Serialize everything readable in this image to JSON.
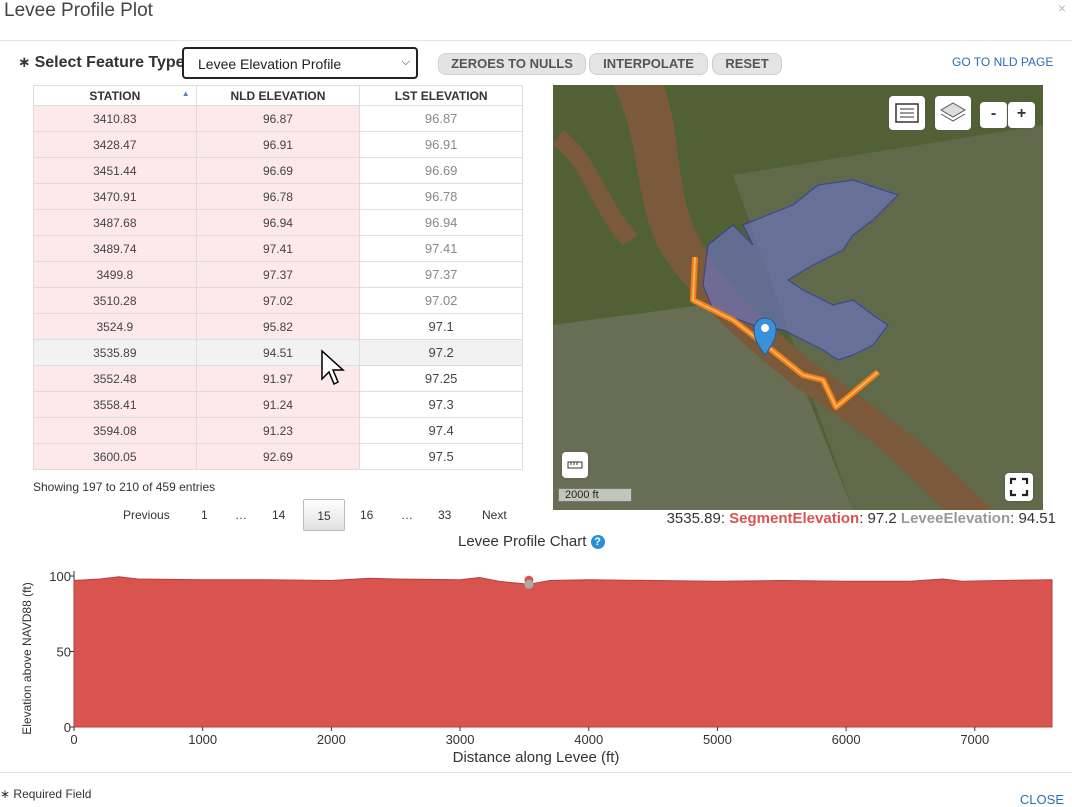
{
  "window": {
    "title": "Levee Profile Plot",
    "close_glyph": "×"
  },
  "form": {
    "required_star": "∗",
    "feature_type_label": "Select Feature Type",
    "feature_type_value": "Levee Elevation Profile"
  },
  "toolbar": {
    "zeroes_to_nulls": "ZEROES TO NULLS",
    "interpolate": "INTERPOLATE",
    "reset": "RESET",
    "nld_link": "GO TO NLD PAGE"
  },
  "table": {
    "columns": [
      "STATION",
      "NLD ELEVATION",
      "LST ELEVATION"
    ],
    "rows": [
      [
        "3410.83",
        "96.87",
        "96.87"
      ],
      [
        "3428.47",
        "96.91",
        "96.91"
      ],
      [
        "3451.44",
        "96.69",
        "96.69"
      ],
      [
        "3470.91",
        "96.78",
        "96.78"
      ],
      [
        "3487.68",
        "96.94",
        "96.94"
      ],
      [
        "3489.74",
        "97.41",
        "97.41"
      ],
      [
        "3499.8",
        "97.37",
        "97.37"
      ],
      [
        "3510.28",
        "97.02",
        "97.02"
      ],
      [
        "3524.9",
        "95.82",
        "97.1"
      ],
      [
        "3535.89",
        "94.51",
        "97.2"
      ],
      [
        "3552.48",
        "91.97",
        "97.25"
      ],
      [
        "3558.41",
        "91.24",
        "97.3"
      ],
      [
        "3594.08",
        "91.23",
        "97.4"
      ],
      [
        "3600.05",
        "92.69",
        "97.5"
      ]
    ],
    "info": "Showing 197 to 210 of 459 entries"
  },
  "pagination": {
    "previous": "Previous",
    "pages": [
      "1",
      "…",
      "14",
      "15",
      "16",
      "…",
      "33"
    ],
    "current": "15",
    "next": "Next"
  },
  "map": {
    "scale_label": "2000 ft",
    "zoom_out": "-",
    "zoom_in": "+",
    "icons": [
      "list-icon",
      "layers-icon",
      "ruler-icon",
      "fullscreen-icon",
      "map-pin-icon"
    ]
  },
  "readout": {
    "station": "3535.89:",
    "segment_label": "SegmentElevation",
    "segment_value": ": 97.2",
    "levee_label": "LeveeElevation",
    "levee_value": ": 94.51"
  },
  "chart_data": {
    "type": "area",
    "title": "Levee Profile Chart",
    "xlabel": "Distance along Levee (ft)",
    "ylabel": "Elevation above NAVD88 (ft)",
    "xlim": [
      0,
      7600
    ],
    "ylim": [
      0,
      100
    ],
    "x_ticks": [
      0,
      1000,
      2000,
      3000,
      4000,
      5000,
      6000,
      7000
    ],
    "y_ticks": [
      0,
      50,
      100
    ],
    "series": [
      {
        "color": "#d9534f",
        "x": [
          0,
          200,
          350,
          500,
          1000,
          1500,
          2000,
          2300,
          2500,
          3000,
          3150,
          3300,
          3535,
          3700,
          4000,
          4500,
          5000,
          5500,
          6000,
          6500,
          6750,
          6900,
          7200,
          7600
        ],
        "y": [
          97,
          98,
          99.5,
          98,
          97.5,
          97.5,
          97,
          98.5,
          98,
          97.5,
          99,
          96.5,
          94.5,
          97,
          97.5,
          97,
          96.5,
          97,
          96.5,
          96.5,
          98,
          96.5,
          97,
          97.5
        ]
      }
    ],
    "markers": [
      {
        "x": 3535,
        "y": 97.2,
        "color": "#d9534f"
      },
      {
        "x": 3535,
        "y": 94.51,
        "color": "#aaaaaa"
      }
    ]
  },
  "footer": {
    "required_field": "Required Field",
    "close": "CLOSE"
  }
}
